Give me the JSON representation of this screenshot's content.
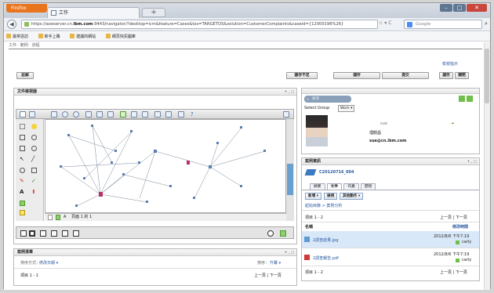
{
  "browser": {
    "app_button": "Firefox",
    "tab_title": "工作",
    "url_prefix": "https://aoeserver.cn.",
    "url_domain": "ibm.com",
    "url_rest": ":9443/navigator/?desktop=icm&feature=Cases&tos=TARGETOS&solution=CustomerComplaints&caseid={12000196%26}",
    "search_placeholder": "Google",
    "bookmarks": [
      "最常造訪",
      "新手上路",
      "建議的網站",
      "網頁快訊圖庫"
    ]
  },
  "page": {
    "breadcrumb": "工作 · 範例 · 流程",
    "case_viewer_link": "檢視指示",
    "submit": "註解",
    "actions": [
      "儲存不足",
      "儲存",
      "提交"
    ],
    "top_right_buttons": [
      "儲存",
      "關閉"
    ]
  },
  "doc_viewer": {
    "title": "文件檢視器",
    "page_label": "頁面 1 的 1",
    "zoom_label": "A"
  },
  "group_panel": {
    "search_placeholder": "搜尋",
    "select_group_label": "Select Group",
    "group_value": "Work",
    "person_role": "sue",
    "person_name": "理觀昌",
    "person_email": "sue@cn.ibm.com"
  },
  "case_info": {
    "title": "案例資訊",
    "case_id": "C20120716_004",
    "tabs": [
      "摘要",
      "文件",
      "作業",
      "歷程"
    ],
    "active_tab": "文件",
    "toolbar": [
      "新增",
      "檢視",
      "其他動作"
    ],
    "path": "起始目錄 > 案例分析",
    "item_count": "項目 1 - 2",
    "pager": "上一頁 | 下一頁",
    "col_name": "名稱",
    "col_modified": "修改時間",
    "files": [
      {
        "name": "2調查結果.jpg",
        "date": "2012/8/6 下午7:19",
        "user": "carly"
      },
      {
        "name": "2調查報告.pdf",
        "date": "2012/8/6 下午7:19",
        "user": "carly"
      }
    ],
    "footer_count": "項目 1 - 2",
    "footer_pager": "上一頁 | 下一頁"
  },
  "case_list": {
    "title": "案例清單",
    "sort_label": "排序方式：",
    "sort_value": "修改日期",
    "order_label": "排序：",
    "order_value": "升冪",
    "item_count": "項目 1 - 1",
    "pager": "上一頁 | 下一頁"
  },
  "colors": {
    "accent": "#2a5aa0",
    "firefox": "#e8741c",
    "selected_row": "#d9e8f8"
  }
}
